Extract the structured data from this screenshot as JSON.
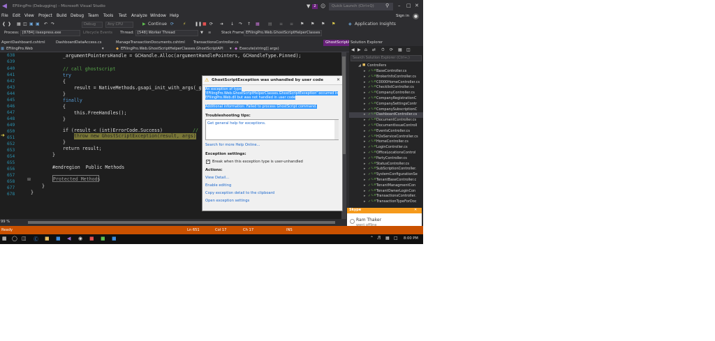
{
  "window": {
    "title": "EFilingPro (Debugging) - Microsoft Visual Studio",
    "notification_count": "2",
    "quick_launch_placeholder": "Quick Launch (Ctrl+Q)"
  },
  "menu": {
    "items": [
      "File",
      "Edit",
      "View",
      "Project",
      "Build",
      "Debug",
      "Team",
      "Tools",
      "Test",
      "Analyze",
      "Window",
      "Help"
    ],
    "sign_in": "Sign in"
  },
  "toolbar": {
    "config": "Debug",
    "platform": "Any CPU",
    "continue": "Continue",
    "app_insights": "Application Insights"
  },
  "process_bar": {
    "process_label": "Process:",
    "process_value": "[8784] iisexpress.exe",
    "lifecycle": "Lifecycle Events",
    "thread_label": "Thread:",
    "thread_value": "[548] Worker Thread",
    "stack_label": "Stack Frame:",
    "stack_value": "EFilingPro.Web.GhostScriptHelperClasses"
  },
  "tabs": [
    "AgentDashboard.cshtml",
    "DashboardDataAccess.cs",
    "ManageTransactionDocuments.cshtml",
    "TransactionsController.cs",
    "GhostScriptAPI.cs"
  ],
  "nav": {
    "project": "EFilingPro.Web",
    "class": "EFilingPro.Web.GhostScriptHelperClasses.GhostScriptAPI",
    "member": "Execute(string[] args)"
  },
  "code": {
    "lines": [
      {
        "n": "638",
        "t": "_argumentPointersHandle = GCHandle.Alloc(argumentHandlePointers, GCHandleType.Pinned);"
      },
      {
        "n": "639",
        "t": ""
      },
      {
        "n": "640",
        "t": "// call ghostscript"
      },
      {
        "n": "641",
        "t": "try"
      },
      {
        "n": "642",
        "t": "{"
      },
      {
        "n": "643",
        "t": "result = NativeMethods.gsapi_init_with_args(_gh"
      },
      {
        "n": "644",
        "t": "}"
      },
      {
        "n": "645",
        "t": "finally"
      },
      {
        "n": "646",
        "t": "{"
      },
      {
        "n": "647",
        "t": "this.FreeHandles();"
      },
      {
        "n": "648",
        "t": "}"
      },
      {
        "n": "649",
        "t": ""
      },
      {
        "n": "650",
        "t": "if (result < (int)ErrorCode.Success)"
      },
      {
        "n": "651",
        "t": "throw new GhostScriptException(result, args);"
      },
      {
        "n": "652",
        "t": "}"
      },
      {
        "n": "653",
        "t": "return result;"
      },
      {
        "n": "654",
        "t": "}"
      },
      {
        "n": "655",
        "t": ""
      },
      {
        "n": "656",
        "t": "#endregion  Public Methods"
      },
      {
        "n": "657",
        "t": ""
      },
      {
        "n": "658",
        "t": "Protected Methods"
      },
      {
        "n": "677",
        "t": "}"
      },
      {
        "n": "678",
        "t": "}"
      }
    ],
    "comment_slash": "//"
  },
  "exception": {
    "title": "GhostScriptException was unhandled by user code",
    "detail_lines": [
      "An exception of type",
      "'EFilingPro.Web.GhostScriptHelperClasses.GhostScriptException' occurred in",
      "EFilingPro.Web.dll but was not handled in user code",
      "",
      "Additional information: Failed to process GhostScript command."
    ],
    "tips_heading": "Troubleshooting tips:",
    "tips_link": "Get general help for exceptions.",
    "help_online": "Search for more Help Online...",
    "settings_heading": "Exception settings:",
    "break_label": "Break when this exception type is user-unhandled",
    "actions_heading": "Actions:",
    "actions": [
      "View Detail...",
      "Enable editing",
      "Copy exception detail to the clipboard",
      "Open exception settings"
    ]
  },
  "solution_explorer": {
    "title": "Solution Explorer",
    "search_placeholder": "Search Solution Explorer (Ctrl+;)",
    "folder": "Controllers",
    "items": [
      "BaseController.cs",
      "BrokerInfoController.cs",
      "C0000HomeController.cs",
      "ChecklistController.cs",
      "CompanyController.cs",
      "CompanyRegistrationC",
      "CompanySettingsContr",
      "CompanySubscriptionC",
      "DashboardController.cs",
      "DocumentController.cs",
      "DocumentIssueControll",
      "EventsController.cs",
      "H2eServiceController.cs",
      "HomeController.cs",
      "LoginController.cs",
      "OfficeLocationsControl",
      "PartyController.cs",
      "StatusController.cs",
      "SubScriptionController.",
      "SystemConfigurationSe",
      "TenantBaseController.c",
      "TenantManagmentCon",
      "TenantOwnerLoginCon",
      "TransactionsController.",
      "TransactionTypeForDoc"
    ]
  },
  "toast": {
    "app": "Skype",
    "name": "Ram Thaker",
    "status": "went offline"
  },
  "editor_footer": {
    "zoom": "99 %"
  },
  "status": {
    "ready": "Ready",
    "ln": "Ln 651",
    "col": "Col 17",
    "ch": "Ch 17",
    "ins": "INS"
  },
  "taskbar": {
    "time": "8:00 PM"
  },
  "colors": {
    "accent": "#68217a",
    "status_bar": "#ca5100",
    "toast": "#f59a1b",
    "highlight": "#c4c04c"
  }
}
